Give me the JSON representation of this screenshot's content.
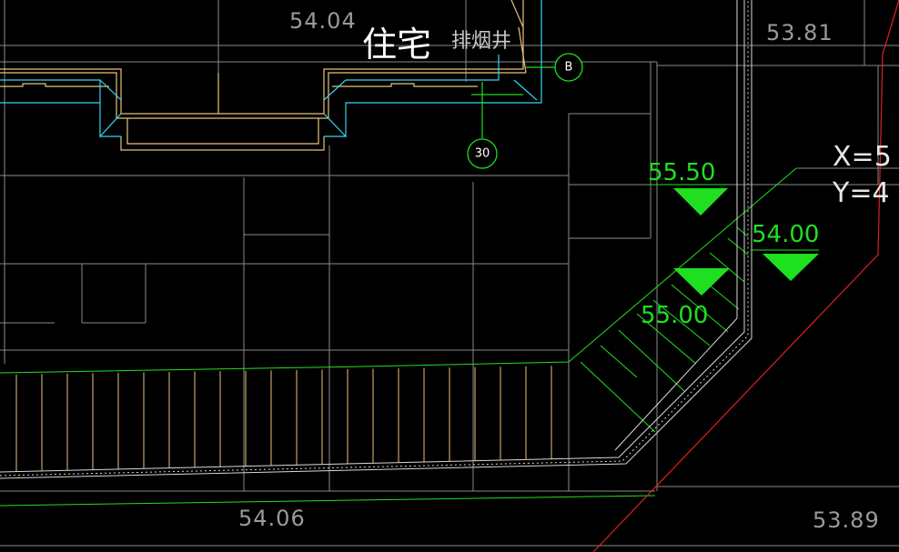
{
  "colors": {
    "background": "#000000",
    "grid_line": "#8a8a8a",
    "building_outline": "#e8c27a",
    "wall_cyan": "#33d6f0",
    "green_annotation": "#1fe01f",
    "red_boundary": "#e02020",
    "road_edge": "#e8c27a"
  },
  "labels": {
    "elevation_top_left": "54.04",
    "elevation_top_right": "53.81",
    "elevation_bottom_left": "54.06",
    "elevation_bottom_right": "53.89",
    "room_name": "住宅",
    "smoke_shaft": "排烟井",
    "axis_b": "B",
    "axis_30": "30",
    "elev_mark_1": "55.50",
    "elev_mark_2": "54.00",
    "elev_mark_3": "55.00",
    "coord_x": "X=5",
    "coord_y": "Y=4"
  },
  "icons": {
    "axis_bubble": "circle-axis-icon",
    "elevation_marker": "triangle-elevation-icon"
  }
}
